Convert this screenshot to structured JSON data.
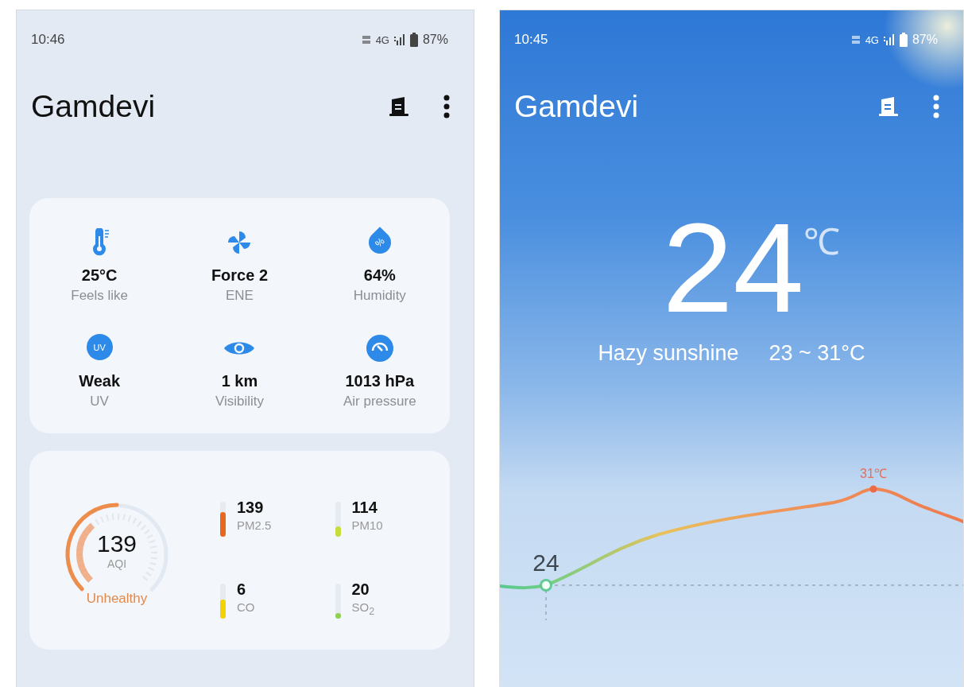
{
  "screens": [
    {
      "kind": "details",
      "status_bar": {
        "time": "10:46",
        "network": "4G",
        "battery": "87%"
      },
      "city": "Gamdevi",
      "details": [
        {
          "kind": "thermometer",
          "value": "25°C",
          "label": "Feels like"
        },
        {
          "kind": "fan",
          "value": "Force 2",
          "label": "ENE"
        },
        {
          "kind": "drop",
          "icon_text": "%",
          "value": "64%",
          "label": "Humidity"
        },
        {
          "kind": "badge",
          "icon_text": "UV",
          "value": "Weak",
          "label": "UV"
        },
        {
          "kind": "eye",
          "value": "1 km",
          "label": "Visibility"
        },
        {
          "kind": "gauge",
          "value": "1013 hPa",
          "label": "Air pressure"
        }
      ],
      "air": {
        "value": "139",
        "label": "AQI",
        "status": "Unhealthy",
        "level": 0.5,
        "pollutants": [
          {
            "value": "139",
            "name": "PM2.5",
            "level": 0.7,
            "color": "#e8661e"
          },
          {
            "value": "114",
            "name": "PM10",
            "level": 0.3,
            "color": "#c6dd3a"
          },
          {
            "value": "6",
            "name": "CO",
            "level": 0.55,
            "color": "#f2d200"
          },
          {
            "value": "20",
            "name": "SO$_{2}$",
            "level": 0.15,
            "color": "#8ed14a"
          }
        ]
      }
    },
    {
      "kind": "current",
      "status_bar": {
        "time": "10:45",
        "network": "4G",
        "battery": "87%"
      },
      "city": "Gamdevi",
      "temperature": "24",
      "unit": "℃",
      "condition": "Hazy sunshine",
      "range": "23 ~ 31°C",
      "curve": {
        "now_label": "24",
        "peak_label": "31℃"
      }
    }
  ]
}
